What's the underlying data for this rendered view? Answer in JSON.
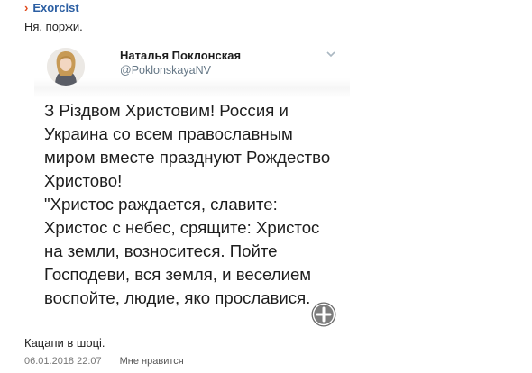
{
  "post": {
    "author": "Exorcist",
    "comment": "Ня, поржи.",
    "reply_text": "Кацапи в шоці.",
    "timestamp": "06.01.2018 22:07",
    "like_label": "Мне нравится"
  },
  "tweet": {
    "display_name": "Наталья Поклонская",
    "handle": "@PoklonskayaNV",
    "lines": [
      "З Різдвом Христовим! Россия и",
      "Украина со всем православным",
      "миром вместе празднуют Рождество",
      "Христово!",
      "\"Христос раждается, славите:",
      "Христос с небес, срящите: Христос",
      "на земли, возноситеся. Пойте",
      "Господеви, вся земля, и веселием",
      "воспойте, людие, яко прославися."
    ]
  },
  "icons": {
    "author_arrow": "chevron-right-icon",
    "tweet_menu": "chevron-down-icon",
    "expand": "plus-circle-icon"
  },
  "colors": {
    "author_link": "#2c5fa3",
    "arrow": "#e0491a",
    "handle": "#657786",
    "meta": "#777777"
  }
}
